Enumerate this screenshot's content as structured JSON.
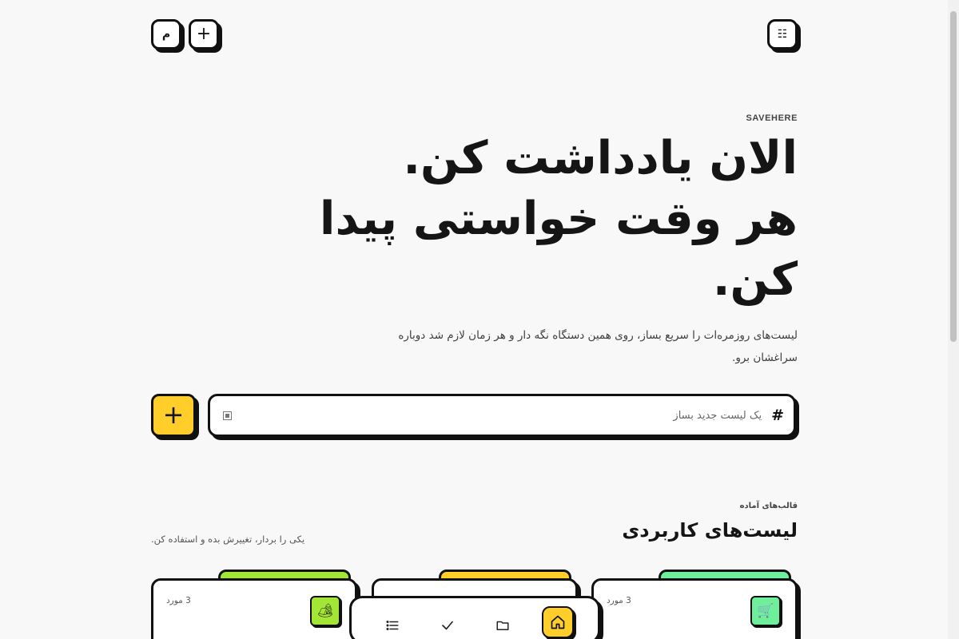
{
  "header": {
    "menu_icon": "list-grid-icon",
    "menu_glyph": "☷",
    "add_glyph": "+",
    "account_glyph": "م"
  },
  "hero": {
    "brand": "SAVEHERE",
    "line1": "الان یادداشت کن.",
    "line2": "هر وقت خواستی پیدا",
    "line3": "کن.",
    "subtitle": "لیست‌های روزمره‌ات را سریع بساز، روی همین دستگاه نگه دار و هر زمان لازم شد دوباره سراغشان برو."
  },
  "new_list": {
    "hash": "#",
    "placeholder": "یک لیست جدید بساز",
    "value": "",
    "create_glyph": "+"
  },
  "templates": {
    "eyebrow": "قالب‌های آماده",
    "title": "لیست‌های کاربردی",
    "hint": "یکی را بردار، تغییرش بده و استفاده کن.",
    "cards": [
      {
        "count": "3 مورد",
        "icon": "cart-icon",
        "glyph": "🛒",
        "color": "#6fef9c"
      },
      {
        "count": "",
        "icon": "template-icon",
        "glyph": "",
        "color": "#ffce2a"
      },
      {
        "count": "3 مورد",
        "icon": "camping-icon",
        "glyph": "🏕",
        "color": "#a3e635"
      }
    ]
  },
  "nav": {
    "items": [
      {
        "name": "home",
        "icon": "home-icon",
        "active": true
      },
      {
        "name": "folders",
        "icon": "folder-icon",
        "active": false
      },
      {
        "name": "done",
        "icon": "check-icon",
        "active": false
      },
      {
        "name": "lists",
        "icon": "list-icon",
        "active": false
      }
    ]
  },
  "colors": {
    "accent": "#ffce2a",
    "ink": "#111111",
    "background": "#f8f8f8"
  }
}
